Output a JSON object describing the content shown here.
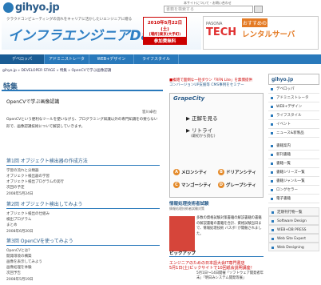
{
  "header": {
    "logo": "gihyo.jp",
    "links": "本サイトについて・お問い合わせ",
    "search_placeholder": "書籍を検索する"
  },
  "banner_left": {
    "tagline": "クラウドコンピューティングの流れをキャリアに活かしたいエンジニアに贈る",
    "title": "インフラエンジニアDay",
    "date": "2010年5月22日(土)",
    "place": "[場所]東京(大手町)",
    "cta": "参加費無料"
  },
  "banner_right": {
    "pasona": "PASONA",
    "tech": "TECH",
    "osusume": "おすすめの",
    "rental": "レンタルサーバ"
  },
  "nav": [
    "デベロッパ",
    "アドミニストレータ",
    "WEB+デザイン",
    "ライフスタイル"
  ],
  "breadcrumb": "gihyo.jp » DEVELOPER STAGE » 特集 » OpenCVで学ぶ画像認識",
  "page_title": "特集",
  "article": {
    "title": "OpenCVで学ぶ画像認識",
    "author": "皆川卓也",
    "intro": "OpenCVという便利なツールを使いながら、プログラミング知識以外の専門知識をの要らない形で、画像認識技術について解説していきます。"
  },
  "sections": [
    {
      "heading": "第1回 オブジェクト検出器の作成方法",
      "lines": [
        "学習の流れと分類器",
        "オブジェクト検出器の学習",
        "オブジェクト検出プログラムの実行",
        "次回の予定"
      ],
      "date": "2008年5月24日"
    },
    {
      "heading": "第2回 オブジェクト検出してみよう",
      "lines": [
        "オブジェクト検出の仕組み",
        "検出プログラム",
        "まとめ"
      ],
      "date": "2008年6月20日"
    },
    {
      "heading": "第3回 OpenCVを使ってみよう",
      "lines": [
        "OpenCVとは？",
        "開発環境の構築",
        "画像を表示してみよう",
        "画像処理を体験",
        "次回予告"
      ],
      "date": "2008年5月19日"
    }
  ],
  "ad": {
    "line1": "■複雑で面倒な一括ダウン「RFN Lite」を無償提供",
    "line2": "コンバージョンUP支援等 CMS事例をセミナー"
  },
  "grapecity": {
    "logo": "GrapeCity",
    "button1": "正解を見る",
    "button2": "リトライ",
    "button2_sub": "(最初から読む)",
    "options": [
      {
        "key": "A",
        "label": "メロンシティ"
      },
      {
        "key": "B",
        "label": "ドリアンシティ"
      },
      {
        "key": "C",
        "label": "マンゴーシティ"
      },
      {
        "key": "D",
        "label": "グレープシティ"
      }
    ]
  },
  "book": {
    "heading": "情報処理技術者試験",
    "sub": "情報処理技術者試験対策",
    "text": "多数の資格試験対策書籍の解説書籍の書籍の解説書籍の書籍を合計、資格試験当日まで、情報処理技術 バスボ! が開催されました。"
  },
  "pickup": {
    "heading": "ピックアップ",
    "title1": "エンジニアのための日本語大会IT専門書店",
    "title2": "5月1日(土)ピックサイトで10回紙会説明講座！",
    "text": "5月1日～14日開催「ソフトウェア開発者年末」「明日みシステム開発等展」"
  },
  "sidebar": {
    "logo": "gihyo.jp",
    "items": [
      "デベロッパ",
      "アドミニストレータ",
      "WEB+デザイン",
      "ライフスタイル",
      "イベント",
      "ニュース&新製品"
    ],
    "items2": [
      "書籍案内",
      "新刊書籍",
      "書籍一覧",
      "書籍シリーズ一覧",
      "書籍ジャンル一覧",
      "ロングセラー",
      "電子書籍"
    ],
    "items3": [
      "定期刊行物一覧",
      "Software Design",
      "WEB+DB PRESS",
      "Web Site Expert",
      "Web Designing"
    ]
  }
}
